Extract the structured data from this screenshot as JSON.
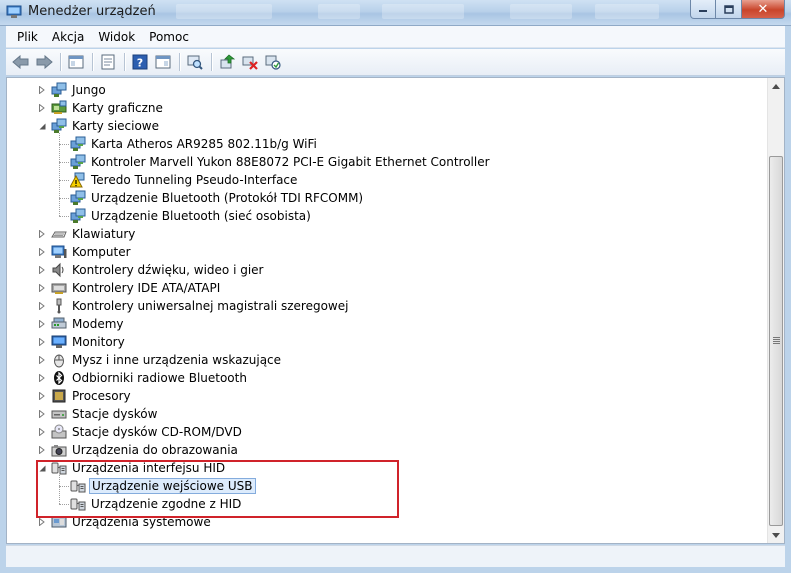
{
  "window": {
    "title": "Menedżer urządzeń",
    "close_glyph": "✕"
  },
  "menu": [
    "Plik",
    "Akcja",
    "Widok",
    "Pomoc"
  ],
  "toolbar": [
    "back-icon",
    "forward-icon",
    "console-tree-icon",
    "properties-icon",
    "help-icon",
    "action-pane-icon",
    "view-icon",
    "update-driver-icon",
    "uninstall-icon",
    "scan-hardware-icon"
  ],
  "tree": [
    {
      "label": "Jungo",
      "level": 0,
      "expanded": false,
      "icon": "device-icon"
    },
    {
      "label": "Karty graficzne",
      "level": 0,
      "expanded": false,
      "icon": "display-adapter-icon"
    },
    {
      "label": "Karty sieciowe",
      "level": 0,
      "expanded": true,
      "icon": "network-adapter-icon"
    },
    {
      "label": "Karta Atheros AR9285 802.11b/g WiFi",
      "level": 1,
      "icon": "network-adapter-icon"
    },
    {
      "label": "Kontroler Marvell Yukon 88E8072 PCI-E Gigabit Ethernet Controller",
      "level": 1,
      "icon": "network-adapter-icon"
    },
    {
      "label": "Teredo Tunneling Pseudo-Interface",
      "level": 1,
      "icon": "warning-network-icon"
    },
    {
      "label": "Urządzenie Bluetooth (Protokół TDI RFCOMM)",
      "level": 1,
      "icon": "network-adapter-icon"
    },
    {
      "label": "Urządzenie Bluetooth (sieć osobista)",
      "level": 1,
      "icon": "network-adapter-icon"
    },
    {
      "label": "Klawiatury",
      "level": 0,
      "expanded": false,
      "icon": "keyboard-icon"
    },
    {
      "label": "Komputer",
      "level": 0,
      "expanded": false,
      "icon": "computer-icon"
    },
    {
      "label": "Kontrolery dźwięku, wideo i gier",
      "level": 0,
      "expanded": false,
      "icon": "speaker-icon"
    },
    {
      "label": "Kontrolery IDE ATA/ATAPI",
      "level": 0,
      "expanded": false,
      "icon": "ide-controller-icon"
    },
    {
      "label": "Kontrolery uniwersalnej magistrali szeregowej",
      "level": 0,
      "expanded": false,
      "icon": "usb-icon"
    },
    {
      "label": "Modemy",
      "level": 0,
      "expanded": false,
      "icon": "modem-icon"
    },
    {
      "label": "Monitory",
      "level": 0,
      "expanded": false,
      "icon": "monitor-icon"
    },
    {
      "label": "Mysz i inne urządzenia wskazujące",
      "level": 0,
      "expanded": false,
      "icon": "mouse-icon"
    },
    {
      "label": "Odbiorniki radiowe Bluetooth",
      "level": 0,
      "expanded": false,
      "icon": "bluetooth-icon"
    },
    {
      "label": "Procesory",
      "level": 0,
      "expanded": false,
      "icon": "processor-icon"
    },
    {
      "label": "Stacje dysków",
      "level": 0,
      "expanded": false,
      "icon": "disk-drive-icon"
    },
    {
      "label": "Stacje dysków CD-ROM/DVD",
      "level": 0,
      "expanded": false,
      "icon": "cdrom-icon"
    },
    {
      "label": "Urządzenia do obrazowania",
      "level": 0,
      "expanded": false,
      "icon": "camera-icon"
    },
    {
      "label": "Urządzenia interfejsu HID",
      "level": 0,
      "expanded": true,
      "icon": "hid-icon"
    },
    {
      "label": "Urządzenie wejściowe USB",
      "level": 1,
      "icon": "hid-icon",
      "selected": true
    },
    {
      "label": "Urządzenie zgodne z HID",
      "level": 1,
      "icon": "hid-icon"
    },
    {
      "label": "Urządzenia systemowe",
      "level": 0,
      "expanded": false,
      "icon": "system-device-icon"
    }
  ]
}
